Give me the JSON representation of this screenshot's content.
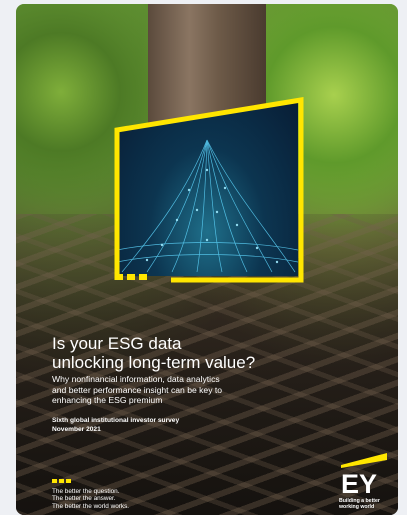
{
  "cover": {
    "headline_line1": "Is your ESG data",
    "headline_line2": "unlocking long-term value?",
    "subhead_line1": "Why nonfinancial information, data analytics",
    "subhead_line2": "and better performance insight can be key to",
    "subhead_line3": "enhancing the ESG premium",
    "survey_title": "Sixth global institutional investor survey",
    "survey_date": "November 2021"
  },
  "tagline": {
    "line1": "The better the question.",
    "line2": "The better the answer.",
    "line3": "The better the world works."
  },
  "brand": {
    "logo_text": "EY",
    "slogan_line1": "Building a better",
    "slogan_line2": "working world",
    "accent_color": "#ffe600"
  }
}
